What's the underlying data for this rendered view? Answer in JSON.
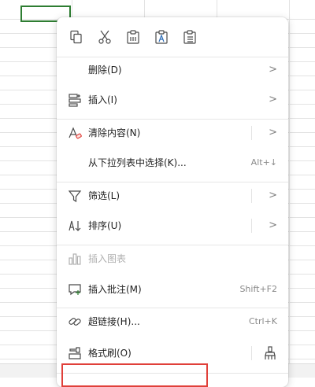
{
  "colors": {
    "accent_green": "#2e7d32",
    "highlight_red": "#e0403a",
    "icon_gray": "#4a4a4a",
    "disabled_gray": "#b0b0b0"
  },
  "toolbar": {
    "items": [
      {
        "name": "copy",
        "icon": "copy-icon"
      },
      {
        "name": "cut",
        "icon": "scissors-icon"
      },
      {
        "name": "paste",
        "icon": "clipboard-icon"
      },
      {
        "name": "paste-text",
        "icon": "clipboard-text-icon"
      },
      {
        "name": "paste-list",
        "icon": "clipboard-list-icon"
      }
    ]
  },
  "menu": {
    "delete": {
      "label": "删除(D)",
      "arrow": ">"
    },
    "insert": {
      "label": "插入(I)",
      "arrow": ">"
    },
    "clear": {
      "label": "清除内容(N)",
      "arrow": ">"
    },
    "pick_list": {
      "label": "从下拉列表中选择(K)...",
      "shortcut": "Alt+↓"
    },
    "filter": {
      "label": "筛选(L)",
      "arrow": ">"
    },
    "sort": {
      "label": "排序(U)",
      "arrow": ">"
    },
    "insert_chart": {
      "label": "插入图表"
    },
    "insert_comment": {
      "label": "插入批注(M)",
      "shortcut": "Shift+F2"
    },
    "hyperlink": {
      "label": "超链接(H)...",
      "shortcut": "Ctrl+K"
    },
    "format_painter": {
      "label": "格式刷(O)"
    }
  }
}
